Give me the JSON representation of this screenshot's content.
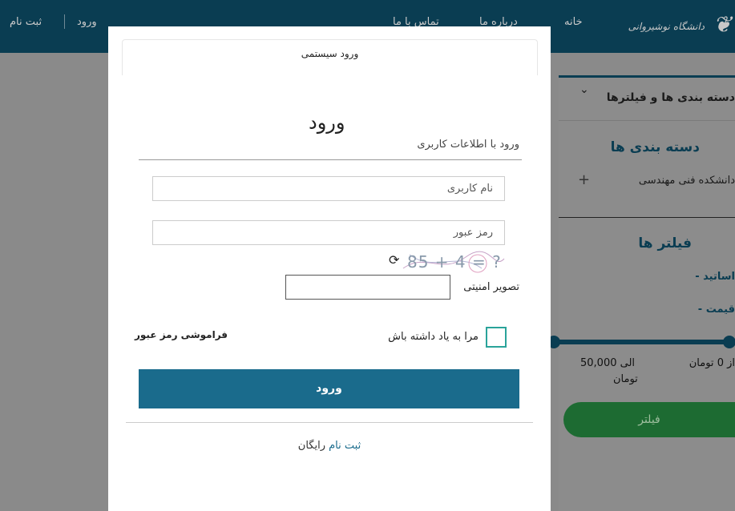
{
  "nav": {
    "home": "خانه",
    "about": "درباره ما",
    "contact": "تماس با ما",
    "login": "ورود",
    "register": "ثبت نام",
    "logo_text": "دانشگاه نوشیروانی"
  },
  "sidebar": {
    "dropdown_title": "دسته بندی ها و فیلترها",
    "categories_title": "دسته بندی ها",
    "category_item": "دانشکده فنی مهندسی",
    "filters_title": "فیلتر ها",
    "filter_professors": "- اساتید",
    "filter_price": "- قیمت",
    "price_from": "از 0 تومان",
    "price_to": "الی 50,000",
    "price_currency": "تومان",
    "filter_button": "فیلتر"
  },
  "modal": {
    "header_title": "ورود سیستمی",
    "title": "ورود",
    "subtitle": "ورود با اطلاعات کاربری",
    "username_placeholder": "نام کاربری",
    "password_placeholder": "رمز عبور",
    "captcha_text": "85 + 4 = ?",
    "captcha_refresh_icon": "refresh-icon",
    "security_label": "تصویر امنیتی",
    "remember_label": "مرا به یاد داشته باش",
    "forgot_password": "فراموشی رمز عبور",
    "login_button": "ورود",
    "register_link": "ثبت نام",
    "register_suffix": " رایگان"
  },
  "colors": {
    "primary": "#1a6b8c",
    "topbar": "#0a3d52",
    "checkbox_border": "#2aa39a",
    "filter_button": "#1d6b32"
  }
}
